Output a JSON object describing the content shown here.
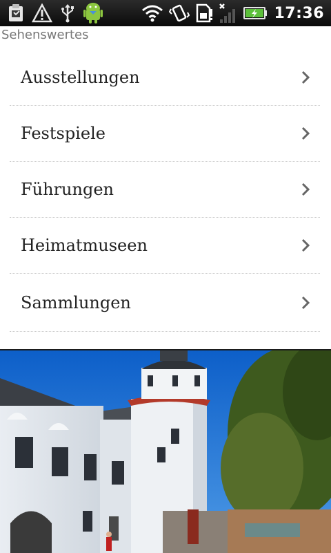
{
  "status_bar": {
    "time": "17:36",
    "left_icons": [
      "clipboard-icon",
      "warning-icon",
      "usb-icon",
      "android-icon"
    ],
    "right_icons": [
      "wifi-icon",
      "vibrate-icon",
      "sim-alert-icon",
      "signal-icon",
      "battery-icon"
    ]
  },
  "header": {
    "label": "Sehenswertes"
  },
  "list": {
    "items": [
      {
        "label": "Ausstellungen"
      },
      {
        "label": "Festspiele"
      },
      {
        "label": "Führungen"
      },
      {
        "label": "Heimatmuseen"
      },
      {
        "label": "Sammlungen"
      }
    ]
  },
  "photo": {
    "subject": "castle-photo"
  },
  "colors": {
    "status_bar": "#111111",
    "header_text": "#777777",
    "item_text": "#222222",
    "chevron": "#666666",
    "divider": "#c8c8c8",
    "sky": "#1f6fd0"
  }
}
